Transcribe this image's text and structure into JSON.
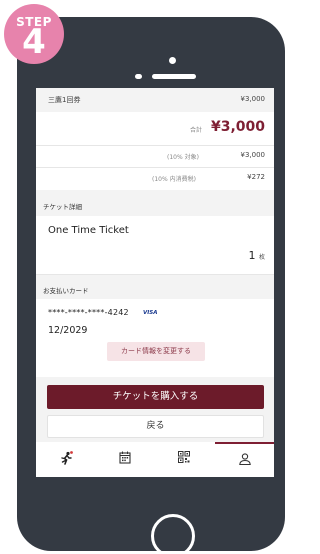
{
  "badge": {
    "step_label": "STEP",
    "step_number": "4"
  },
  "summary": {
    "ticket_label": "三鷹1回券",
    "ticket_price": "¥3,000",
    "total_label": "合計",
    "total_price": "¥3,000",
    "tax_label": "(10% 対象)",
    "tax_amount": "¥3,000",
    "tax_inclusive_label": "(10% 内消費税)",
    "tax_inclusive_amount": "¥272"
  },
  "ticket_detail": {
    "section_title": "チケット詳細",
    "product_name": "One Time Ticket",
    "quantity": "1",
    "quantity_unit": "枚"
  },
  "payment": {
    "section_title": "お支払いカード",
    "card_number": "****-****-****-4242",
    "card_brand": "VISA",
    "card_expiry": "12/2029",
    "change_label": "カード情報を変更する"
  },
  "actions": {
    "buy_label": "チケットを購入する",
    "back_label": "戻る"
  },
  "tabbar": {
    "items": [
      {
        "icon": "runner-icon",
        "active": false
      },
      {
        "icon": "calendar-icon",
        "active": false
      },
      {
        "icon": "qr-code-icon",
        "active": false
      },
      {
        "icon": "user-icon",
        "active": true
      }
    ]
  },
  "colors": {
    "brand": "#6c1b2a",
    "accent": "#7e1f33",
    "badge": "#e783ac",
    "phone": "#343a43"
  }
}
